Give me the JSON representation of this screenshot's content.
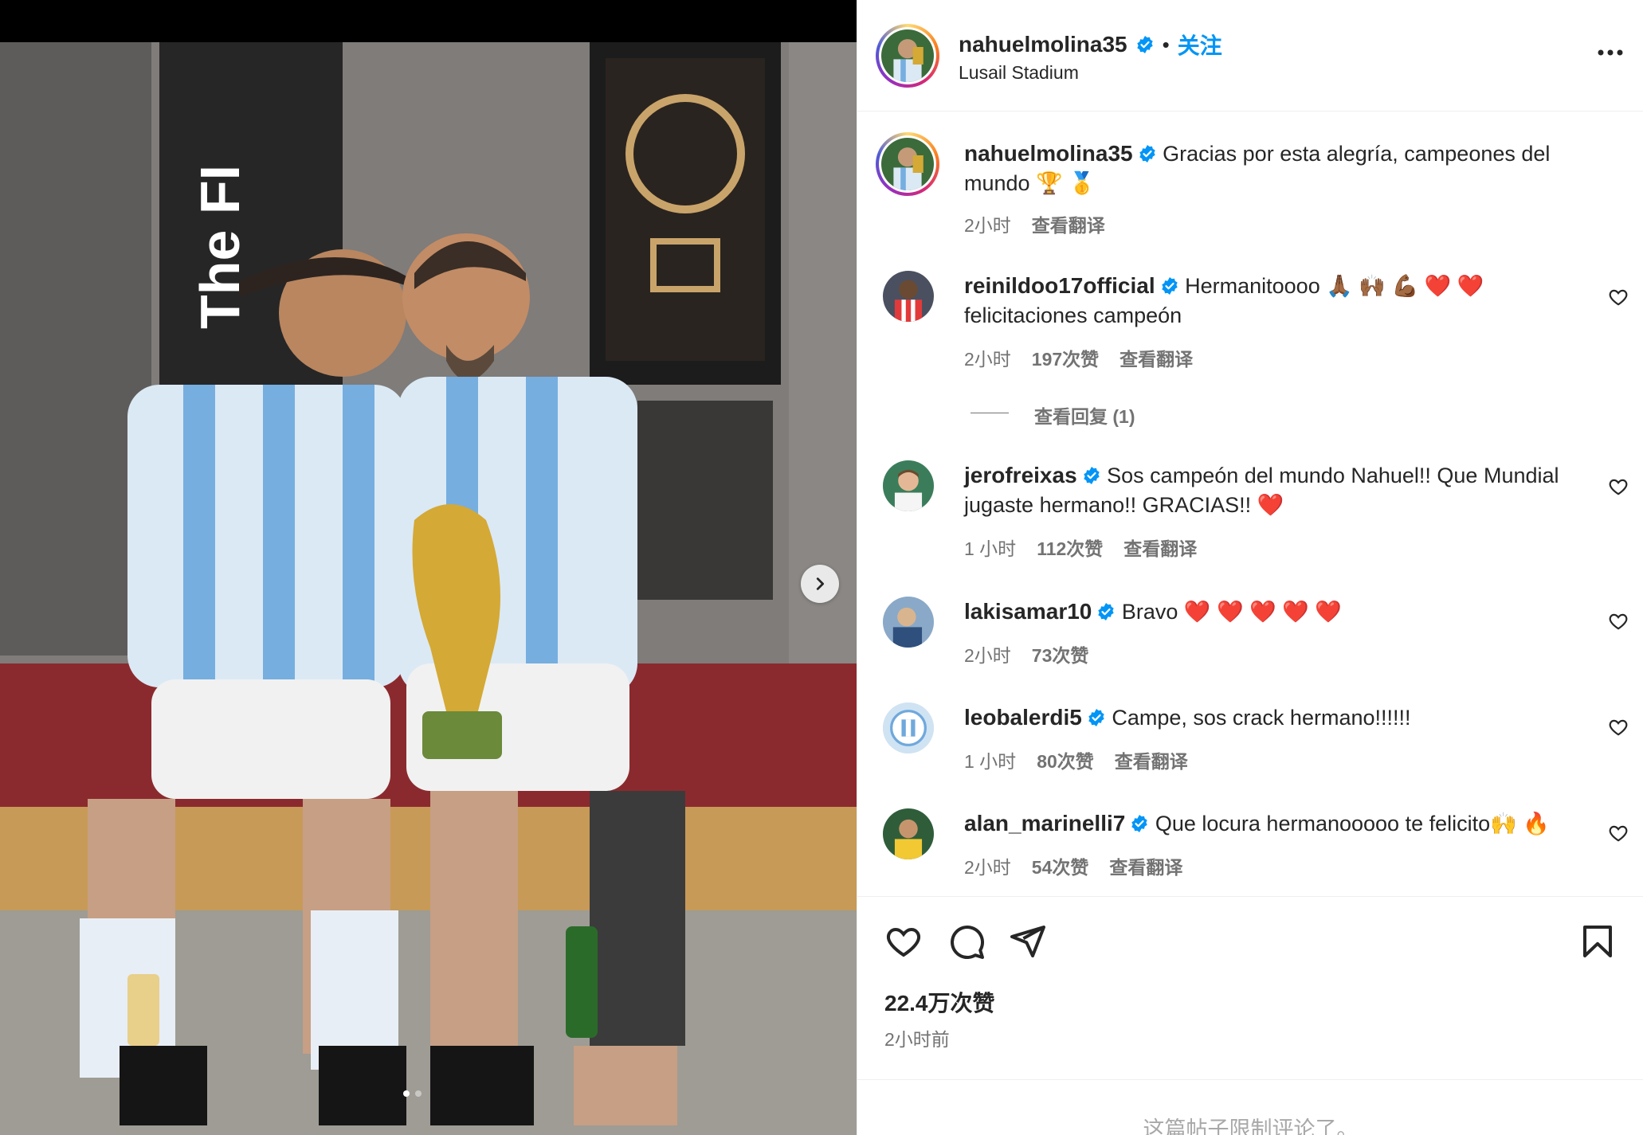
{
  "post": {
    "media_alt": "Two Argentina players seated on a locker room bench holding the World Cup trophy"
  },
  "header": {
    "username": "nahuelmolina35",
    "separator": "•",
    "follow_label": "关注",
    "location": "Lusail Stadium"
  },
  "caption": {
    "username": "nahuelmolina35",
    "text_line1": "Gracias por esta alegría, campeones del",
    "text_line2": "mundo 🏆 🥇",
    "time": "2小时",
    "translate": "查看翻译"
  },
  "comments": [
    {
      "username": "reinildoo17official",
      "text_line1": "Hermanitoooo 🙏🏾 🙌🏾 💪🏾 ❤️ ❤️",
      "text_line2": "felicitaciones campeón",
      "time": "2小时",
      "likes": "197次赞",
      "translate": "查看翻译",
      "view_replies": "查看回复 (1)"
    },
    {
      "username": "jerofreixas",
      "text_line1": "Sos campeón del mundo Nahuel!! Que Mundial",
      "text_line2": "jugaste hermano!! GRACIAS!! ❤️",
      "time": "1 小时",
      "likes": "112次赞",
      "translate": "查看翻译"
    },
    {
      "username": "lakisamar10",
      "text_line1": "Bravo ❤️ ❤️ ❤️ ❤️ ❤️",
      "time": "2小时",
      "likes": "73次赞"
    },
    {
      "username": "leobalerdi5",
      "text_line1": "Campe, sos crack hermano!!!!!!",
      "time": "1 小时",
      "likes": "80次赞",
      "translate": "查看翻译"
    },
    {
      "username": "alan_marinelli7",
      "text_line1": "Que locura hermanooooo te felicito🙌 🔥",
      "time": "2小时",
      "likes": "54次赞",
      "translate": "查看翻译"
    }
  ],
  "stats": {
    "likes": "22.4万次赞",
    "posted": "2小时前"
  },
  "footer": {
    "comments_limited": "这篇帖子限制评论了。"
  },
  "carousel": {
    "current_index": 1,
    "total": 2
  },
  "colors": {
    "accent": "#0095f6",
    "verified": "#0095f6",
    "muted": "#737373",
    "text": "#262626",
    "heart": "#ed1c24"
  },
  "icons": [
    "heart-icon",
    "comment-icon",
    "share-icon",
    "bookmark-icon",
    "more-icon",
    "verified-badge-icon",
    "chevron-right-icon"
  ]
}
